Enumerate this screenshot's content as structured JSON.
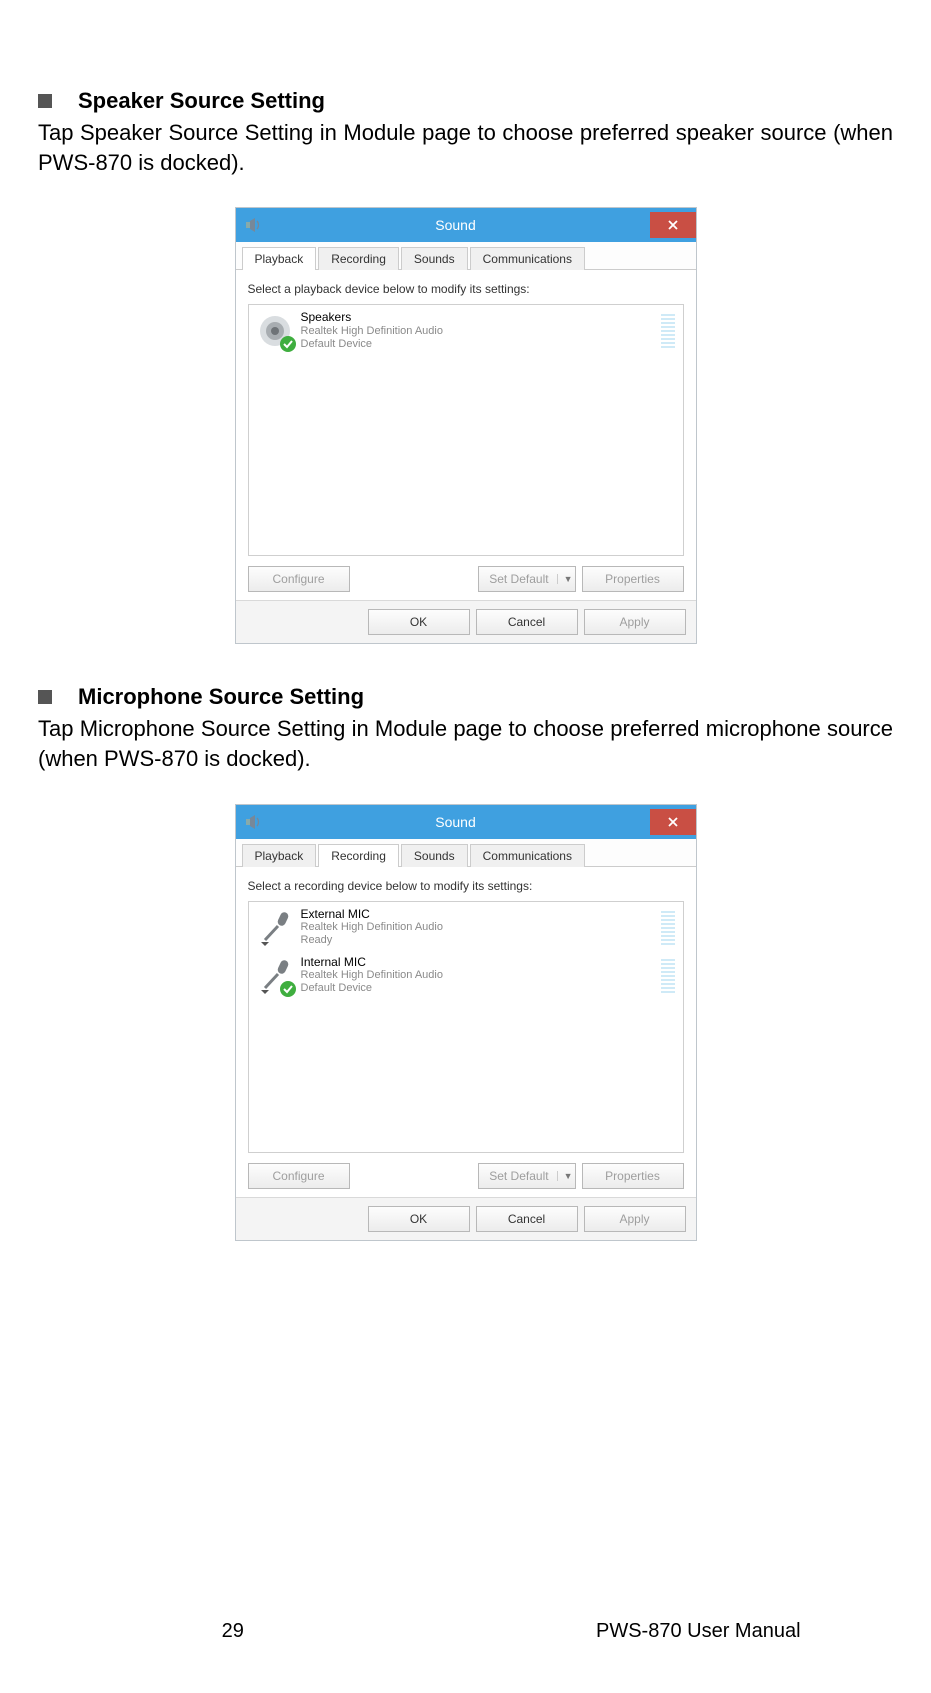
{
  "section1": {
    "heading": "Speaker Source Setting",
    "para": "Tap Speaker Source Setting in Module page to choose preferred speaker source (when PWS-870 is docked)."
  },
  "section2": {
    "heading": "Microphone Source Setting",
    "para": "Tap Microphone Source Setting in Module page to choose preferred microphone source (when PWS-870 is docked)."
  },
  "dlg": {
    "title": "Sound",
    "tabs": {
      "playback": "Playback",
      "recording": "Recording",
      "sounds": "Sounds",
      "comms": "Communications"
    },
    "instr_playback": "Select a playback device below to modify its settings:",
    "instr_recording": "Select a recording device below to modify its settings:",
    "playback_items": [
      {
        "name": "Speakers",
        "sub1": "Realtek High Definition Audio",
        "sub2": "Default Device"
      }
    ],
    "recording_items": [
      {
        "name": "External MIC",
        "sub1": "Realtek High Definition Audio",
        "sub2": "Ready"
      },
      {
        "name": "Internal MIC",
        "sub1": "Realtek High Definition Audio",
        "sub2": "Default Device"
      }
    ],
    "buttons": {
      "configure": "Configure",
      "setdefault": "Set Default",
      "properties": "Properties",
      "ok": "OK",
      "cancel": "Cancel",
      "apply": "Apply"
    }
  },
  "footer": {
    "page": "29",
    "manual": "PWS-870 User Manual"
  }
}
